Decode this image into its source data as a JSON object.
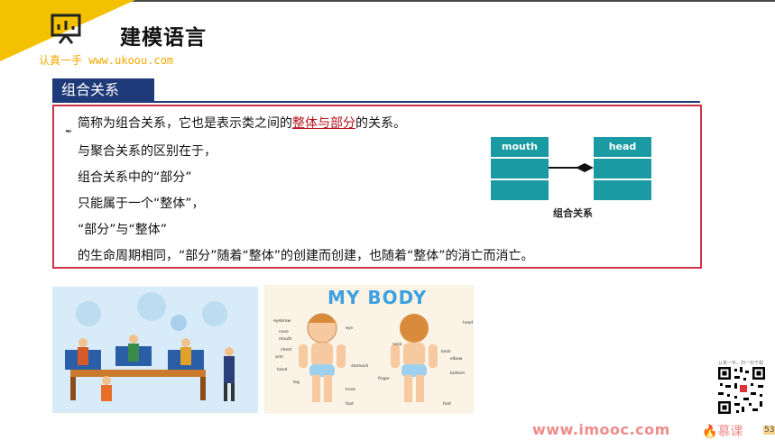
{
  "header": {
    "title": "建模语言",
    "slogan": "认真一手 www.ukoou.com"
  },
  "section": {
    "label": "组合关系"
  },
  "content": {
    "line1_a": "简称为组合关系，它也是表示类之间的",
    "line1_link": "整体与部分",
    "line1_b": "的关系。",
    "line2": "与聚合关系的区别在于，",
    "line3": "组合关系中的“部分”",
    "line4": "只能属于一个“整体”，",
    "line5": "“部分”与“整体”",
    "line6": "的生命周期相同，“部分”随着“整体”的创建而创建，也随着“整体”的消亡而消亡。"
  },
  "diagram": {
    "left_class": "mouth",
    "right_class": "head",
    "caption": "组合关系",
    "accent": "#1a9aa3"
  },
  "images": {
    "team_illustration": "people-working-at-computers-illustration",
    "body_chart_title": "MY BODY",
    "body_labels": [
      "eyebrow",
      "eye",
      "nose",
      "mouth",
      "chest",
      "arm",
      "stomach",
      "hand",
      "leg",
      "knee",
      "foot",
      "head",
      "neck",
      "back",
      "elbow",
      "bottom",
      "finger",
      "foot"
    ]
  },
  "qr": {
    "caption": "认真一手，扫一扫下载"
  },
  "footer": {
    "site": "www.imooc.com",
    "brand": "慕课",
    "page": "53"
  },
  "colors": {
    "brand_yellow": "#f4c100",
    "section_blue": "#1f3a78",
    "border_red": "#cc3344",
    "highlight_red": "#b5121b"
  }
}
